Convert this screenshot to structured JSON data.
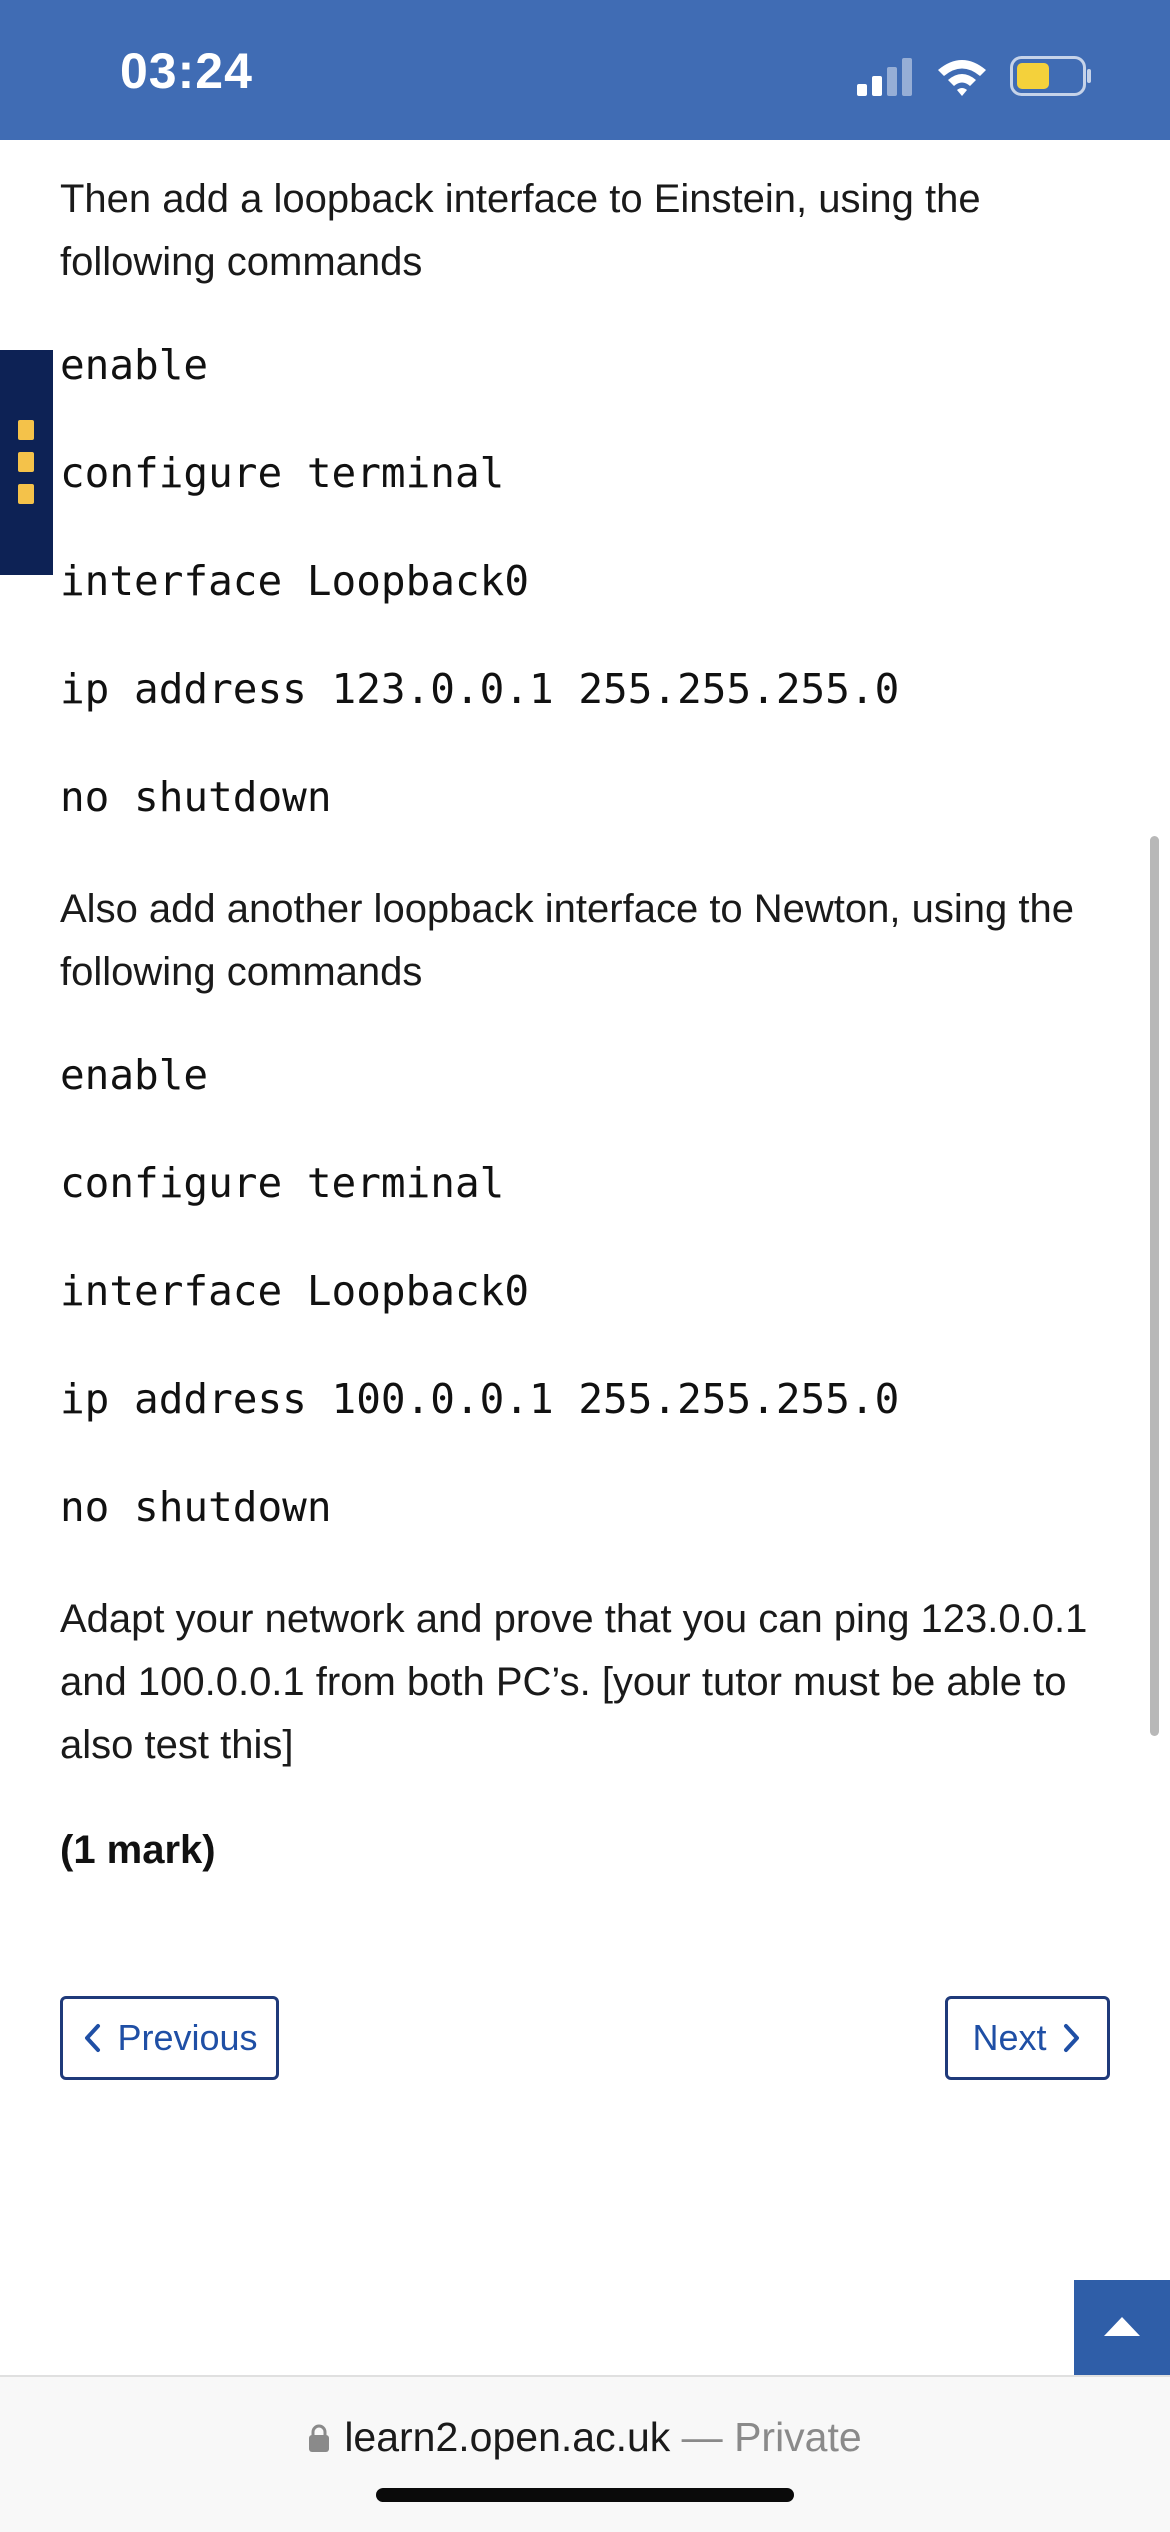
{
  "status": {
    "time": "03:24",
    "signal_icon": "cellular-signal-icon",
    "wifi_icon": "wifi-icon",
    "battery_icon": "battery-icon",
    "battery_color": "#f4d13b",
    "bar_color": "#406cb4"
  },
  "content": {
    "intro_einstein": "Then add a loopback interface to Einstein, using the following commands",
    "einstein_commands": [
      "enable",
      "configure terminal",
      "interface Loopback0",
      "ip address 123.0.0.1 255.255.255.0",
      "no shutdown"
    ],
    "intro_newton": "Also add another loopback interface to Newton, using the following commands",
    "newton_commands": [
      "enable",
      "configure terminal",
      "interface Loopback0",
      "ip address 100.0.0.1 255.255.255.0",
      "no shutdown"
    ],
    "task": "Adapt your network and prove that you can ping 123.0.0.1 and 100.0.0.1 from both PC’s. [your tutor must be able to also test this]",
    "mark": "(1 mark)"
  },
  "nav": {
    "previous_label": "Previous",
    "next_label": "Next"
  },
  "browser": {
    "domain": "learn2.open.ac.uk",
    "separator": " — ",
    "privacy": "Private"
  }
}
